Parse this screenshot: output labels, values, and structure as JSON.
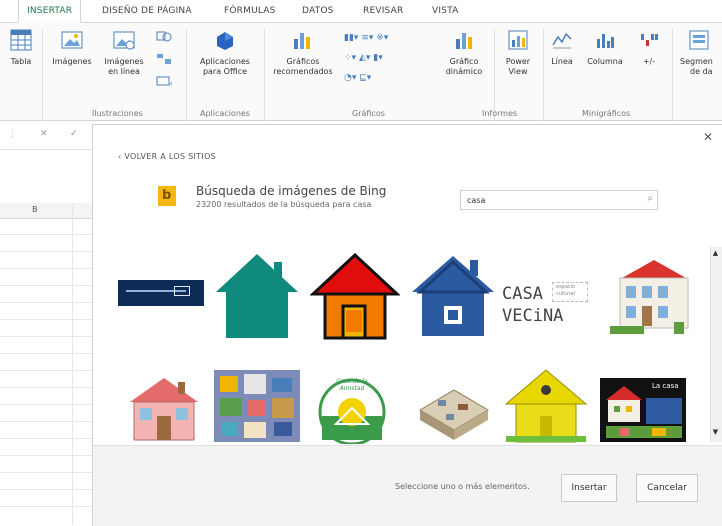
{
  "ribbon": {
    "tabs": [
      "INSERTAR",
      "DISEÑO DE PÁGINA",
      "FÓRMULAS",
      "DATOS",
      "REVISAR",
      "VISTA"
    ],
    "buttons": {
      "tabla": "Tabla",
      "imagenes": "Imágenes",
      "imagenes_linea_1": "Imágenes",
      "imagenes_linea_2": "en línea",
      "apps_1": "Aplicaciones",
      "apps_2": "para Office",
      "graf_rec_1": "Gráficos",
      "graf_rec_2": "recomendados",
      "graf_din_1": "Gráfico",
      "graf_din_2": "dinámico",
      "power_1": "Power",
      "power_2": "View",
      "linea": "Línea",
      "columna": "Columna",
      "ganancia": "+/-",
      "segmen_1": "Segmen",
      "segmen_2": "de da"
    },
    "groups": [
      "Ilustraciones",
      "Aplicaciones",
      "Gráficos",
      "Informes",
      "Minigráficos"
    ]
  },
  "sheet": {
    "cancel_symbol": "✕",
    "enter_symbol": "✓",
    "column_b": "B"
  },
  "dialog": {
    "back_link": "‹ VOLVER A LOS SITIOS",
    "close": "✕",
    "search_title": "Búsqueda de imágenes de Bing",
    "search_subtitle": "23200 resultados de la búsqueda para casa",
    "search_value": "casa",
    "thumb_texts": {
      "casa_vecina_1": "CASA",
      "casa_vecina_2": "VECiNA",
      "espacio_1": "espacio",
      "espacio_2": "cultural",
      "la_casa": "La casa",
      "circle_text": "Casa de la Amistad"
    },
    "footer_message": "Seleccione uno o más elementos.",
    "insert_button": "Insertar",
    "cancel_button": "Cancelar"
  },
  "colors": {
    "accent": "#217346",
    "teal_house": "#108a7d",
    "blue_house": "#2c5aa0",
    "red_roof": "#e10c0c",
    "orange_wall": "#f07b00",
    "bing_yellow": "#f6b711"
  }
}
